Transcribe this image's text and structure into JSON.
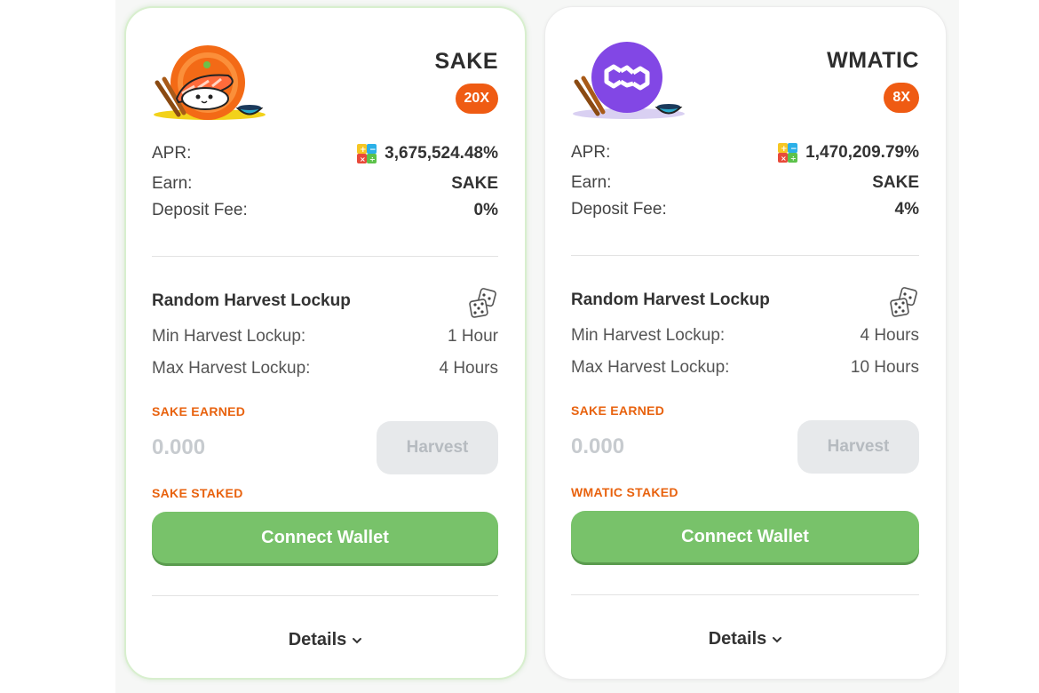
{
  "cards": [
    {
      "token": "SAKE",
      "multiplier": "20X",
      "apr_label": "APR:",
      "apr_value": "3,675,524.48%",
      "earn_label": "Earn:",
      "earn_value": "SAKE",
      "fee_label": "Deposit Fee:",
      "fee_value": "0%",
      "section_title": "Random Harvest Lockup",
      "min_label": "Min Harvest Lockup:",
      "min_value": "1 Hour",
      "max_label": "Max Harvest Lockup:",
      "max_value": "4 Hours",
      "earned_label": "SAKE EARNED",
      "earned_value": "0.000",
      "harvest_label": "Harvest",
      "staked_label": "SAKE STAKED",
      "connect_label": "Connect Wallet",
      "details_label": "Details",
      "logo_icon": "sushi-logo-icon"
    },
    {
      "token": "WMATIC",
      "multiplier": "8X",
      "apr_label": "APR:",
      "apr_value": "1,470,209.79%",
      "earn_label": "Earn:",
      "earn_value": "SAKE",
      "fee_label": "Deposit Fee:",
      "fee_value": "4%",
      "section_title": "Random Harvest Lockup",
      "min_label": "Min Harvest Lockup:",
      "min_value": "4 Hours",
      "max_label": "Max Harvest Lockup:",
      "max_value": "10 Hours",
      "earned_label": "SAKE EARNED",
      "earned_value": "0.000",
      "harvest_label": "Harvest",
      "staked_label": "WMATIC STAKED",
      "connect_label": "Connect Wallet",
      "details_label": "Details",
      "logo_icon": "polygon-logo-icon"
    }
  ],
  "colors": {
    "multiplier_badge": "#ef5b13",
    "accent_label": "#e8620e",
    "connect_button": "#78c26a",
    "harvest_disabled": "#e7e9eb",
    "polygon_purple": "#8247e5"
  }
}
